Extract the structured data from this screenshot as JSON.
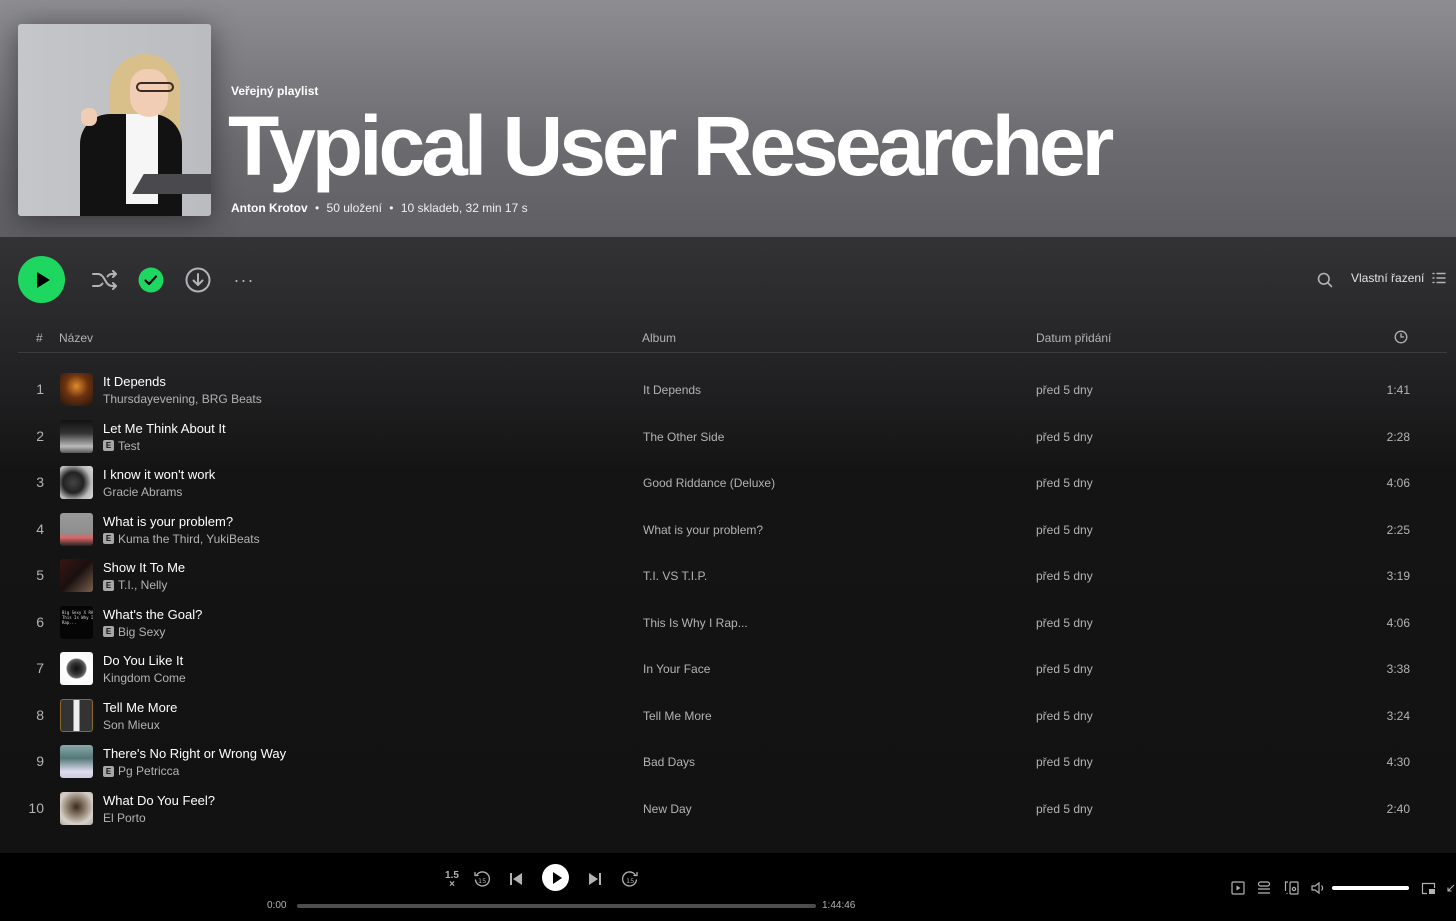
{
  "playlist": {
    "type_label": "Veřejný playlist",
    "title": "Typical User Researcher",
    "owner": "Anton Krotov",
    "saves": "50 uložení",
    "summary": "10 skladeb, 32 min 17 s",
    "separator": "•"
  },
  "actions": {
    "play_icon": "play-icon",
    "shuffle_icon": "shuffle-icon",
    "saved_icon": "check-circle-icon",
    "download_icon": "download-icon",
    "more_label": "···",
    "search_icon": "search-icon",
    "sort_label": "Vlastní řazení",
    "sort_icon": "list-icon"
  },
  "table_header": {
    "num": "#",
    "title": "Název",
    "album": "Album",
    "date_added": "Datum přidání",
    "duration_icon": "clock-icon"
  },
  "tracks": [
    {
      "num": "1",
      "title": "It Depends",
      "artist": "Thursdayevening, BRG Beats",
      "explicit": false,
      "album": "It Depends",
      "date_added": "před 5 dny",
      "duration": "1:41"
    },
    {
      "num": "2",
      "title": "Let Me Think About It",
      "artist": "Test",
      "explicit": true,
      "album": "The Other Side",
      "date_added": "před 5 dny",
      "duration": "2:28"
    },
    {
      "num": "3",
      "title": "I know it won't work",
      "artist": "Gracie Abrams",
      "explicit": false,
      "album": "Good Riddance (Deluxe)",
      "date_added": "před 5 dny",
      "duration": "4:06"
    },
    {
      "num": "4",
      "title": "What is your problem?",
      "artist": "Kuma the Third, YukiBeats",
      "explicit": true,
      "album": "What is your problem?",
      "date_added": "před 5 dny",
      "duration": "2:25"
    },
    {
      "num": "5",
      "title": "Show It To Me",
      "artist": "T.I., Nelly",
      "explicit": true,
      "album": "T.I. VS T.I.P.",
      "date_added": "před 5 dny",
      "duration": "3:19"
    },
    {
      "num": "6",
      "title": "What's the Goal?",
      "artist": "Big Sexy",
      "explicit": true,
      "album": "This Is Why I Rap...",
      "date_added": "před 5 dny",
      "duration": "4:06"
    },
    {
      "num": "7",
      "title": "Do You Like It",
      "artist": "Kingdom Come",
      "explicit": false,
      "album": "In Your Face",
      "date_added": "před 5 dny",
      "duration": "3:38"
    },
    {
      "num": "8",
      "title": "Tell Me More",
      "artist": "Son Mieux",
      "explicit": false,
      "album": "Tell Me More",
      "date_added": "před 5 dny",
      "duration": "3:24"
    },
    {
      "num": "9",
      "title": "There's No Right or Wrong Way",
      "artist": "Pg Petricca",
      "explicit": true,
      "album": "Bad Days",
      "date_added": "před 5 dny",
      "duration": "4:30"
    },
    {
      "num": "10",
      "title": "What Do You Feel?",
      "artist": "El Porto",
      "explicit": false,
      "album": "New Day",
      "date_added": "před 5 dny",
      "duration": "2:40"
    }
  ],
  "explicit_label": "E",
  "thumb6_text": "Big Sexy X RAP\nThis Is Why I\nRap...",
  "player": {
    "speed_label": "1.5",
    "speed_suffix": "×",
    "current_time": "0:00",
    "total_time": "1:44:46",
    "progress": 0.0,
    "volume": 1.0
  },
  "colors": {
    "accent": "#1ed760",
    "background": "#121212",
    "header_gradient_top": "#8d8d92",
    "text_secondary": "#b3b3b3"
  }
}
